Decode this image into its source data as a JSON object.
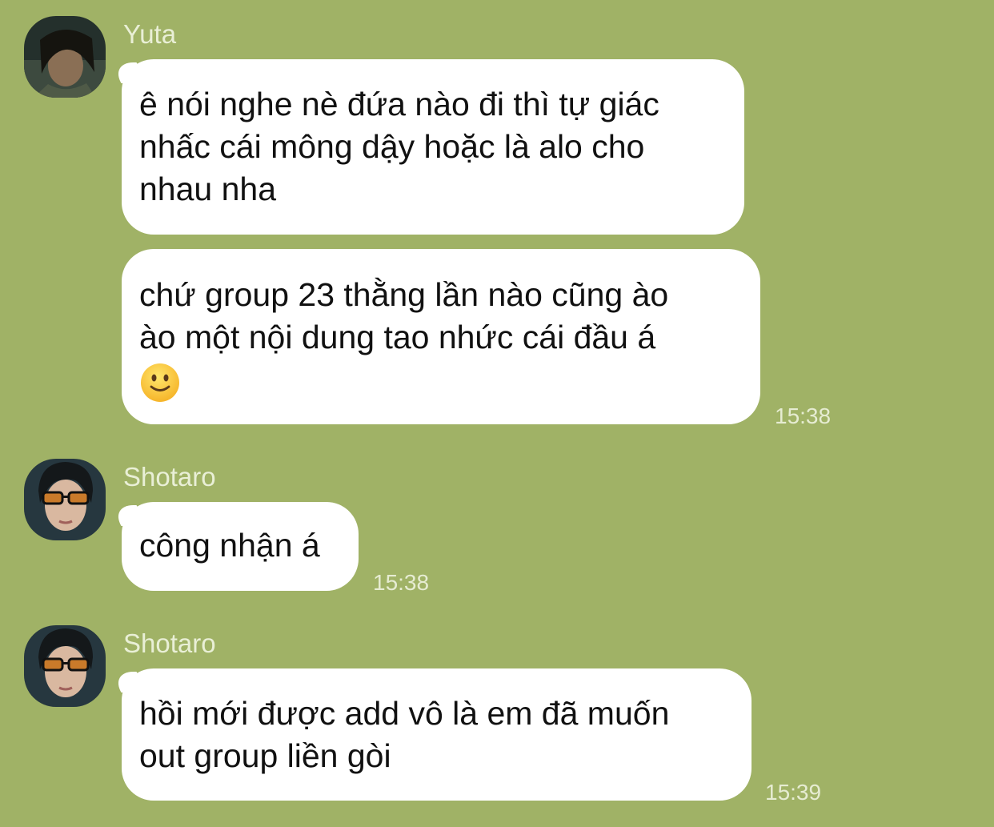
{
  "chat": {
    "groups": [
      {
        "sender": "Yuta",
        "avatar_icon": "yuta-avatar",
        "messages": [
          {
            "lines": [
              "ê nói nghe nè đứa nào đi thì tự giác",
              "nhấc cái mông dậy hoặc là alo cho",
              "nhau nha"
            ]
          },
          {
            "lines": [
              "chứ group 23 thằng lần nào cũng ào",
              "ào một nội dung tao nhức cái đầu á"
            ],
            "emoji": "slightly-smiling-face",
            "time": "15:38"
          }
        ]
      },
      {
        "sender": "Shotaro",
        "avatar_icon": "shotaro-avatar",
        "messages": [
          {
            "lines": [
              "công nhận á"
            ],
            "time": "15:38"
          }
        ]
      },
      {
        "sender": "Shotaro",
        "avatar_icon": "shotaro-avatar",
        "messages": [
          {
            "lines": [
              "hồi mới được add vô là em đã muốn",
              "out group liền gòi"
            ],
            "time": "15:39"
          }
        ]
      }
    ]
  },
  "colors": {
    "background": "#a0b266",
    "bubble": "#ffffff",
    "meta_text": "#e6ecd2"
  }
}
